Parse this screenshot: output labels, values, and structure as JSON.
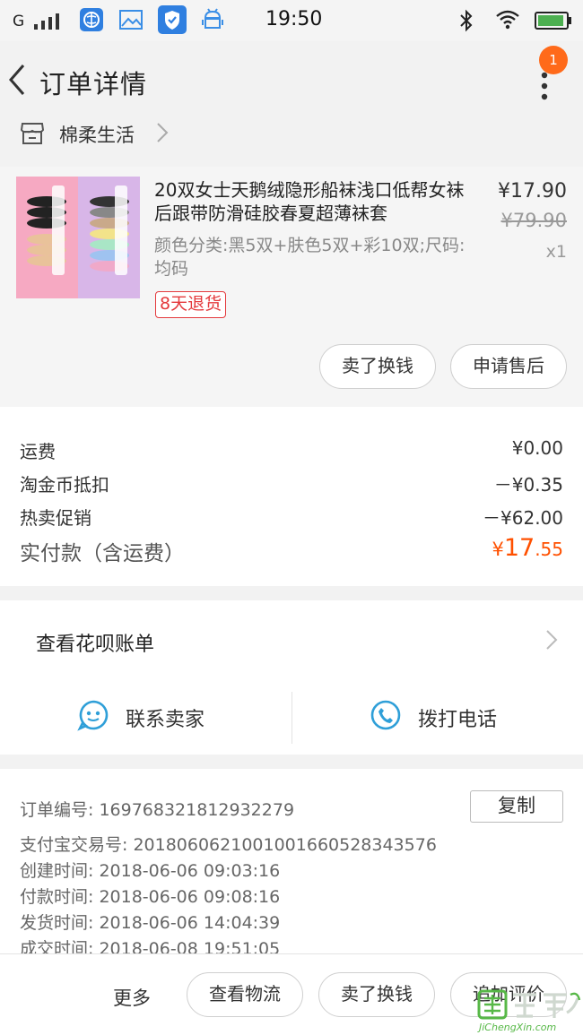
{
  "status_bar": {
    "carrier": "G",
    "time": "19:50"
  },
  "header": {
    "title": "订单详情",
    "badge_count": "1"
  },
  "shop": {
    "name": "棉柔生活"
  },
  "product": {
    "title": "20双女士天鹅绒隐形船袜浅口低帮女袜后跟带防滑硅胶春夏超薄袜套",
    "spec": "颜色分类:黑5双+肤色5双+彩10双;尺码:均码",
    "price": "¥17.90",
    "original_price": "¥79.90",
    "quantity": "x1",
    "return_tag": "8天退货",
    "btn_sell": "卖了换钱",
    "btn_after_sale": "申请售后"
  },
  "costs": {
    "shipping_label": "运费",
    "shipping_value": "¥0.00",
    "coin_label": "淘金币抵扣",
    "coin_value": "－¥0.35",
    "promo_label": "热卖促销",
    "promo_value": "－¥62.00",
    "paid_label": "实付款（含运费）",
    "paid_currency": "¥",
    "paid_int": "17",
    "paid_dec": ".55"
  },
  "huabei": {
    "label": "查看花呗账单"
  },
  "contact": {
    "seller": "联系卖家",
    "phone": "拨打电话"
  },
  "order_info": {
    "order_no": "订单编号:  169768321812932279",
    "copy_btn": "复制",
    "alipay_no": "支付宝交易号:  2018060621001001660528343576",
    "created": "创建时间:   2018-06-06 09:03:16",
    "paid": "付款时间:   2018-06-06 09:08:16",
    "shipped": "发货时间:   2018-06-06 14:04:39",
    "completed": "成交时间:   2018-06-08 19:51:05"
  },
  "bottom_bar": {
    "more": "更多",
    "logistics": "查看物流",
    "sell": "卖了换钱",
    "review": "追加评价"
  },
  "watermark": {
    "text": "JiChengXin.com"
  },
  "colors": {
    "accent_orange": "#ff5000",
    "return_red": "#e4393c",
    "icon_blue": "#2f9fd8"
  }
}
